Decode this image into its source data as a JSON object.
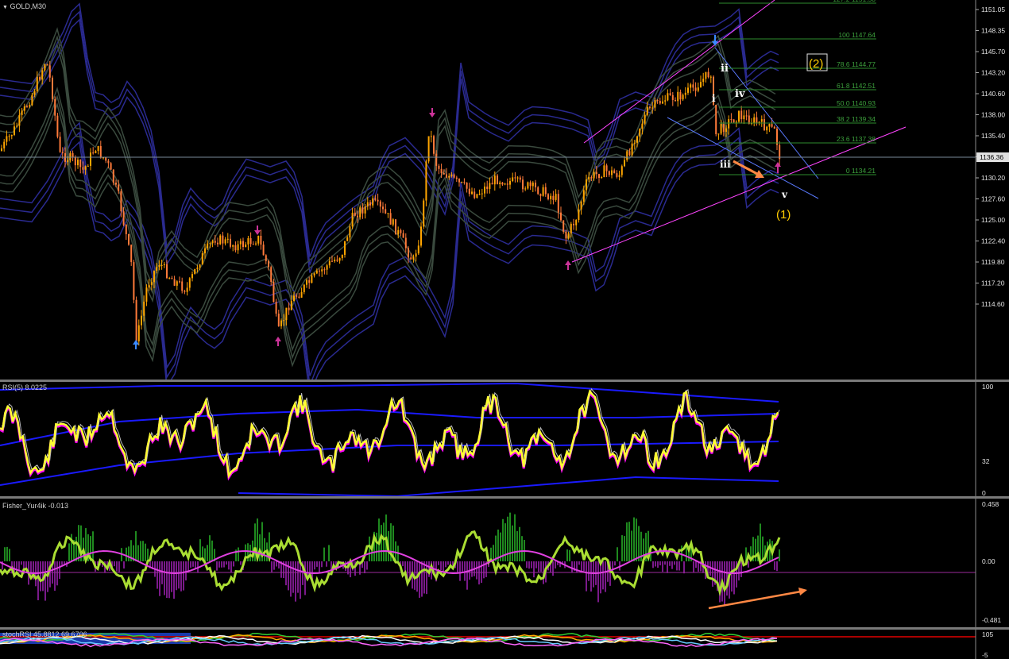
{
  "main_chart": {
    "title": "GOLD,M30",
    "current_price": "1136.36",
    "price_axis": [
      "1151.05",
      "1148.35",
      "1145.70",
      "1143.20",
      "1140.60",
      "1138.00",
      "1135.40",
      "1132.80",
      "1130.20",
      "1127.60",
      "1125.00",
      "1122.40",
      "1119.80",
      "1117.20",
      "1114.60"
    ],
    "fib_levels": [
      "127.2 1151.50",
      "100 1147.64",
      "78.6 1144.77",
      "61.8 1142.51",
      "50.0 1140.93",
      "38.2 1139.34",
      "23.6 1137.38",
      "0 1134.21"
    ],
    "wave_labels": {
      "ii": "ii",
      "i": "i",
      "iv": "iv",
      "iii": "iii",
      "v": "v",
      "w1": "(1)",
      "w2": "(2)"
    },
    "colors": {
      "bull": "#ffa500",
      "bear": "#ff7a3a",
      "bands": "#2a2a90",
      "inner": "#3a4a3e",
      "channel": "#ff44ff",
      "fib": "#2e8b2e"
    }
  },
  "rsi": {
    "title": "RSI(5) 8.0225",
    "axis": [
      "100",
      "32",
      "0"
    ]
  },
  "fisher": {
    "title": "Fisher_Yur4ik -0.013",
    "axis": [
      "0.458",
      "0.00",
      "-0.481"
    ]
  },
  "stoch": {
    "title": "stochRSI 45.8812 69.6706",
    "axis": [
      "105",
      "-5"
    ]
  }
}
